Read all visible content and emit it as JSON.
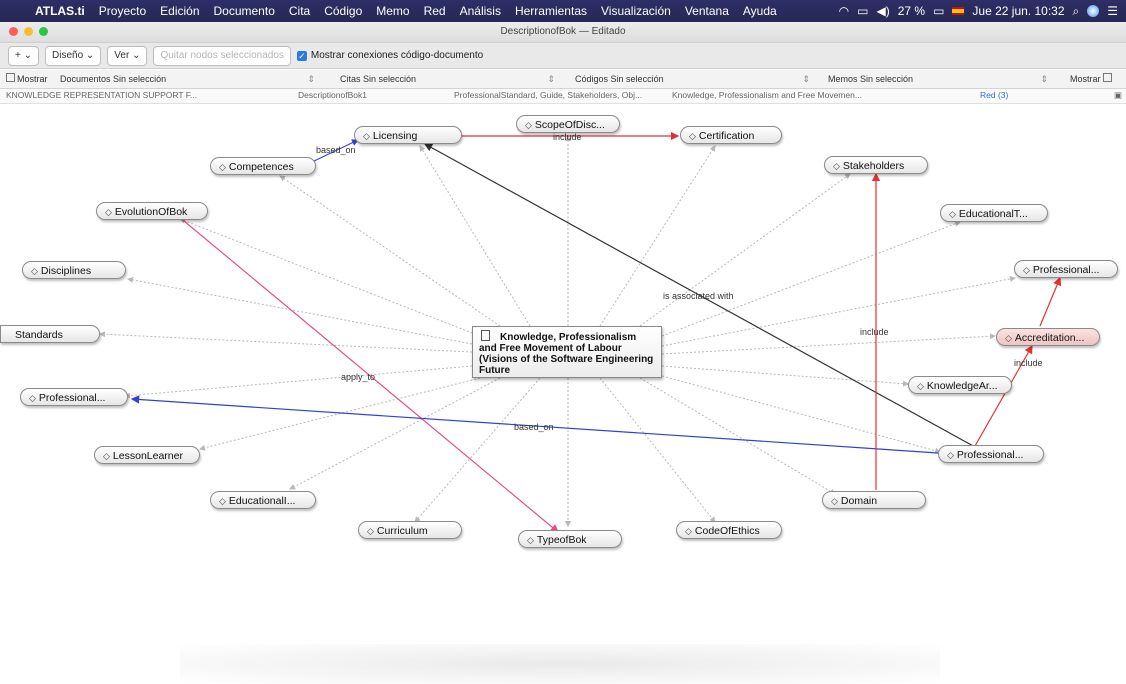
{
  "menubar": {
    "app": "ATLAS.ti",
    "items": [
      "Proyecto",
      "Edición",
      "Documento",
      "Cita",
      "Código",
      "Memo",
      "Red",
      "Análisis",
      "Herramientas",
      "Visualización",
      "Ventana",
      "Ayuda"
    ],
    "battery": "27 %",
    "datetime": "Jue 22 jun. 10:32"
  },
  "window": {
    "title": "DescriptionofBok — Editado"
  },
  "toolbar": {
    "add": "+ ⌄",
    "layout": "Diseño ⌄",
    "view": "Ver ⌄",
    "remove_nodes": "Quitar nodos seleccionados",
    "show_connections": "Mostrar conexiones código-documento"
  },
  "selectors": {
    "show_left": "Mostrar",
    "documents": "Documentos",
    "documents_value": "Sin selección",
    "quotes": "Citas",
    "quotes_value": "Sin selección",
    "codes": "Códigos",
    "codes_value": "Sin selección",
    "memos": "Memos",
    "memos_value": "Sin selección",
    "show_right": "Mostrar"
  },
  "info_row": {
    "doc": "KNOWLEDGE REPRESENTATION SUPPORT F...",
    "quote": "DescriptionofBok1",
    "codes": "ProfessionalStandard, Guide, Stakeholders, Obj...",
    "memo": "Knowledge, Professionalism and Free Movemen...",
    "network": "Red (3)"
  },
  "central": {
    "label": "Knowledge, Professionalism and Free Movement of Labour (Visions of the Software Engineering Future"
  },
  "nodes": {
    "licensing": "Licensing",
    "scope": "ScopeOfDisc...",
    "certification": "Certification",
    "competences": "Competences",
    "stakeholders": "Stakeholders",
    "evolution": "EvolutionOfBok",
    "educationalT": "EducationalT...",
    "disciplines": "Disciplines",
    "professional_r1": "Professional...",
    "standards": "Standards",
    "accreditation": "Accreditation...",
    "professional_l": "Professional...",
    "knowledgeAr": "KnowledgeAr...",
    "lessonlearner": "LessonLearner",
    "professional_r2": "Professional...",
    "educationalI": "EducationalI...",
    "domain": "Domain",
    "curriculum": "Curriculum",
    "typeofbok": "TypeofBok",
    "codeofethics": "CodeOfEthics"
  },
  "edge_labels": {
    "based_on_1": "based_on",
    "include_1": "include",
    "associated": "is associated with",
    "apply_to": "apply_to",
    "based_on_2": "based_on",
    "include_2": "include",
    "include_3": "include"
  },
  "colors": {
    "red_link": "#e53030",
    "pink_link": "#e84d8a",
    "blue_link": "#3240d0",
    "black_link": "#333333",
    "gray_link": "#b8b8b8"
  }
}
